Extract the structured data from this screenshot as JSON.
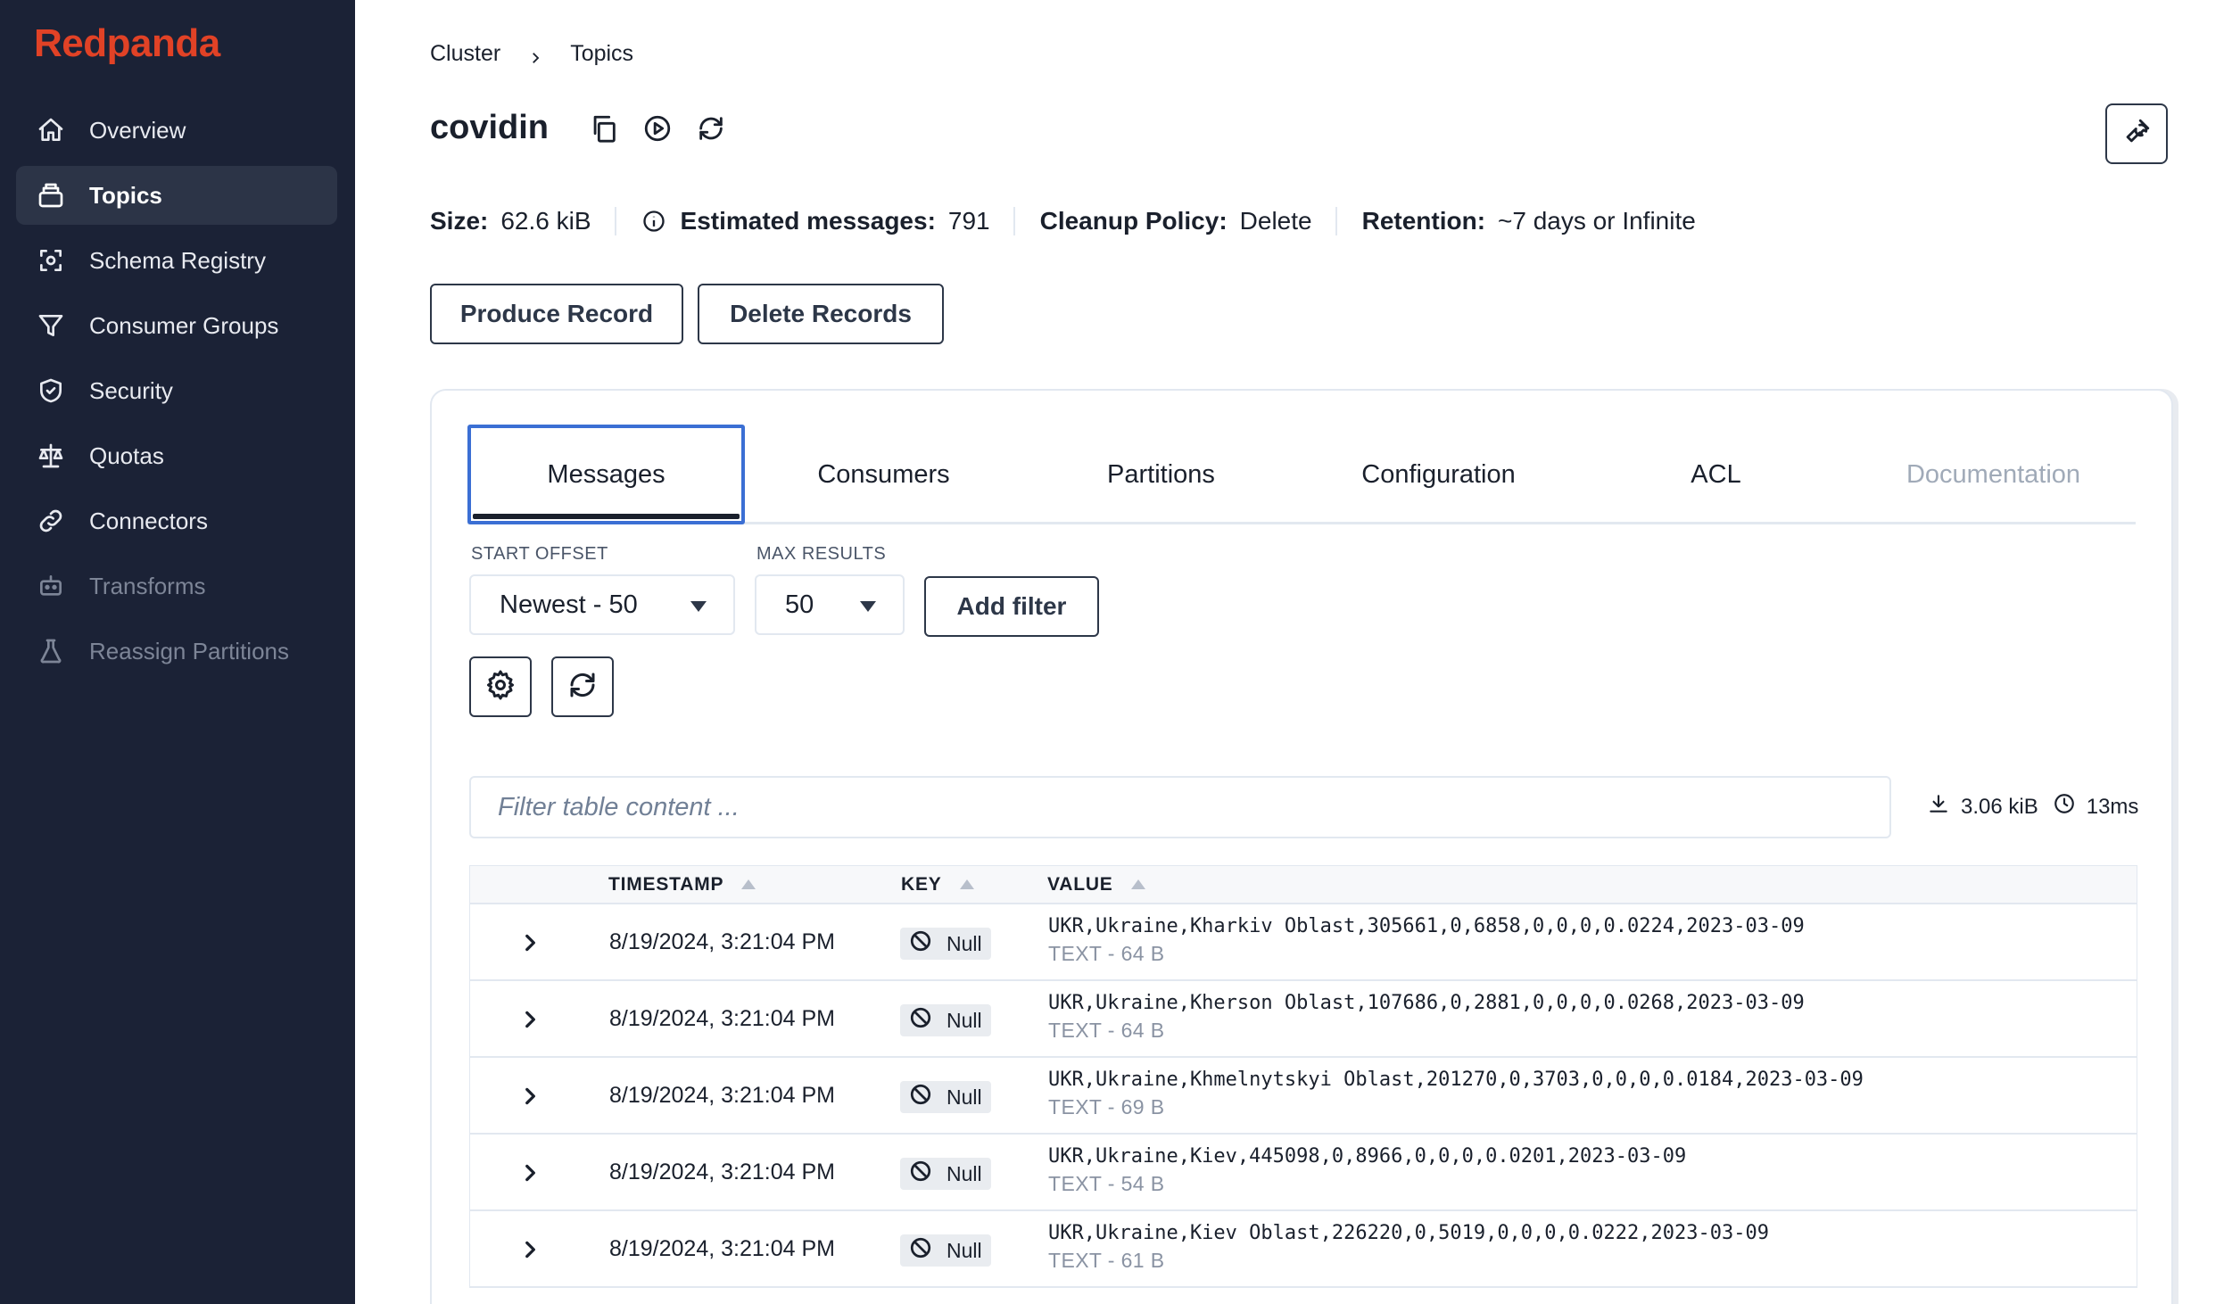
{
  "brand": {
    "name": "Redpanda",
    "color": "#e14226"
  },
  "sidebar": {
    "items": [
      {
        "label": "Overview",
        "icon": "home-icon"
      },
      {
        "label": "Topics",
        "icon": "topics-icon",
        "active": true
      },
      {
        "label": "Schema Registry",
        "icon": "schema-icon"
      },
      {
        "label": "Consumer Groups",
        "icon": "filter-icon"
      },
      {
        "label": "Security",
        "icon": "shield-icon"
      },
      {
        "label": "Quotas",
        "icon": "scale-icon"
      },
      {
        "label": "Connectors",
        "icon": "link-icon"
      },
      {
        "label": "Transforms",
        "icon": "robot-icon",
        "disabled": true
      },
      {
        "label": "Reassign Partitions",
        "icon": "flask-icon",
        "disabled": true
      }
    ]
  },
  "breadcrumb": {
    "cluster": "Cluster",
    "topics": "Topics"
  },
  "topic": {
    "name": "covidin"
  },
  "stats": {
    "size_label": "Size:",
    "size_value": "62.6 kiB",
    "messages_label": "Estimated messages:",
    "messages_value": "791",
    "cleanup_label": "Cleanup Policy:",
    "cleanup_value": "Delete",
    "retention_label": "Retention:",
    "retention_value": "~7 days or Infinite"
  },
  "actions": {
    "produce": "Produce Record",
    "delete": "Delete Records"
  },
  "tabs": [
    {
      "label": "Messages",
      "active": true
    },
    {
      "label": "Consumers"
    },
    {
      "label": "Partitions"
    },
    {
      "label": "Configuration"
    },
    {
      "label": "ACL"
    },
    {
      "label": "Documentation",
      "disabled": true
    }
  ],
  "controls": {
    "start_offset_label": "START OFFSET",
    "start_offset_value": "Newest - 50",
    "max_results_label": "MAX RESULTS",
    "max_results_value": "50",
    "add_filter": "Add filter",
    "filter_placeholder": "Filter table content ...",
    "download_size": "3.06 kiB",
    "duration": "13ms"
  },
  "table": {
    "headers": {
      "timestamp": "TIMESTAMP",
      "key": "KEY",
      "value": "VALUE"
    },
    "rows": [
      {
        "timestamp": "8/19/2024, 3:21:04 PM",
        "key": "Null",
        "value": "UKR,Ukraine,Kharkiv Oblast,305661,0,6858,0,0,0,0.0224,2023-03-09",
        "type": "TEXT - 64 B"
      },
      {
        "timestamp": "8/19/2024, 3:21:04 PM",
        "key": "Null",
        "value": "UKR,Ukraine,Kherson Oblast,107686,0,2881,0,0,0,0.0268,2023-03-09",
        "type": "TEXT - 64 B"
      },
      {
        "timestamp": "8/19/2024, 3:21:04 PM",
        "key": "Null",
        "value": "UKR,Ukraine,Khmelnytskyi Oblast,201270,0,3703,0,0,0,0.0184,2023-03-09",
        "type": "TEXT - 69 B"
      },
      {
        "timestamp": "8/19/2024, 3:21:04 PM",
        "key": "Null",
        "value": "UKR,Ukraine,Kiev,445098,0,8966,0,0,0,0.0201,2023-03-09",
        "type": "TEXT - 54 B"
      },
      {
        "timestamp": "8/19/2024, 3:21:04 PM",
        "key": "Null",
        "value": "UKR,Ukraine,Kiev Oblast,226220,0,5019,0,0,0,0.0222,2023-03-09",
        "type": "TEXT - 61 B"
      }
    ]
  }
}
